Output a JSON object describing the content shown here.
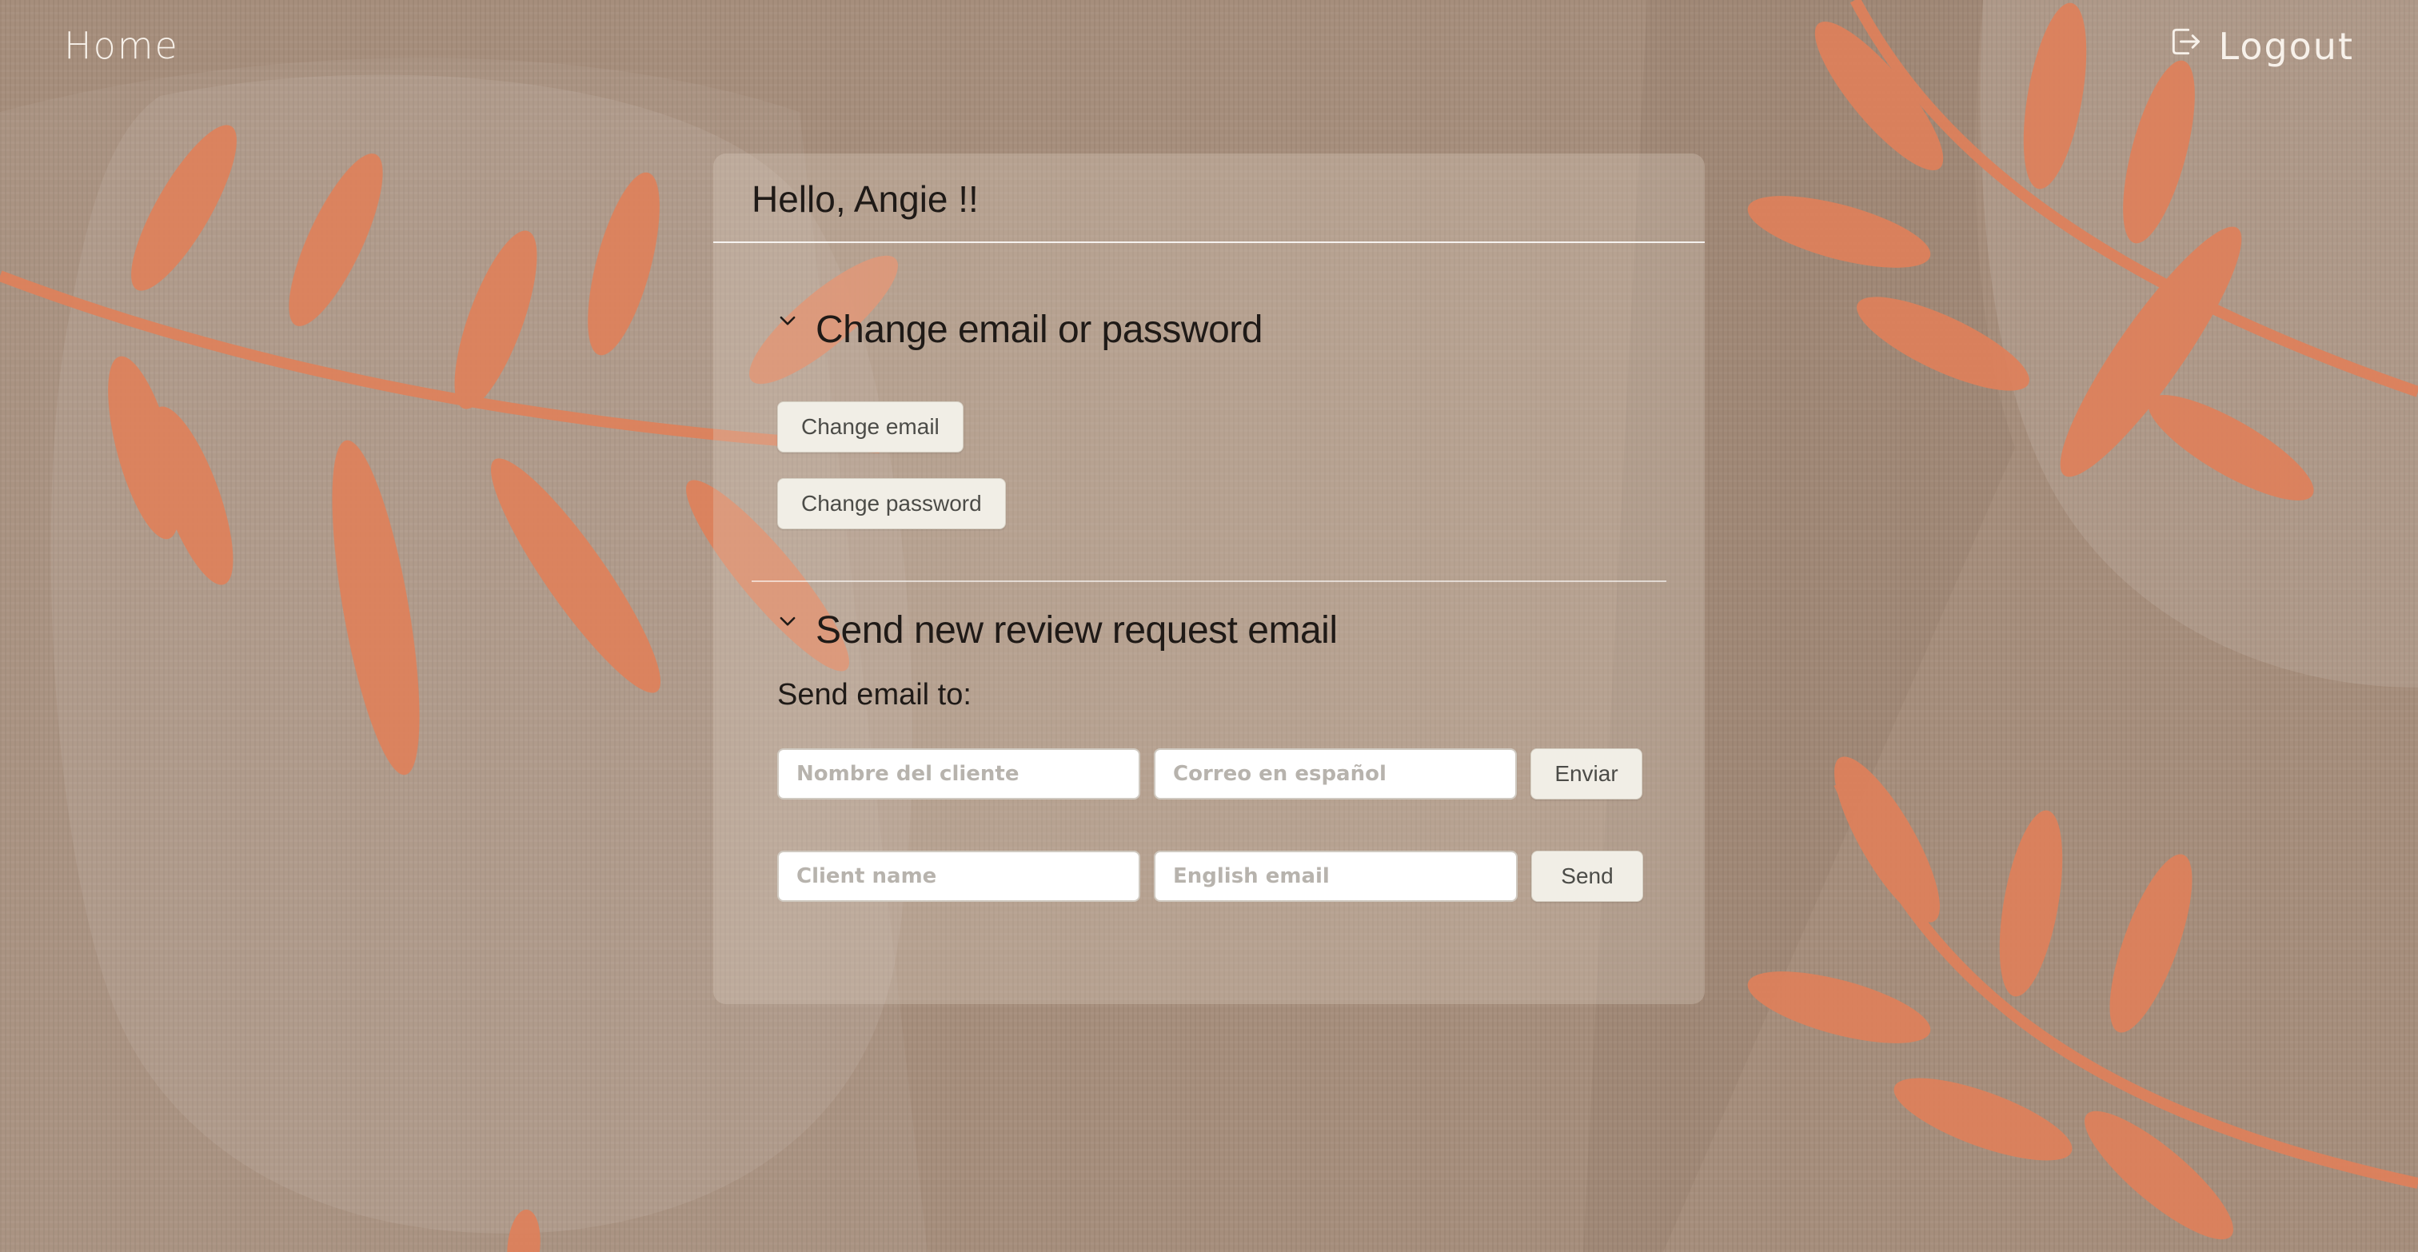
{
  "nav": {
    "home_label": "Home",
    "logout_label": "Logout",
    "logout_icon": "logout-icon"
  },
  "card": {
    "greeting": "Hello, Angie !!",
    "account_section": {
      "title": "Change email or password",
      "change_email_label": "Change email",
      "change_password_label": "Change password"
    },
    "review_section": {
      "title": "Send new review request email",
      "send_to_label": "Send email to:",
      "spanish_row": {
        "name_placeholder": "Nombre del cliente",
        "email_placeholder": "Correo en español",
        "submit_label": "Enviar"
      },
      "english_row": {
        "name_placeholder": "Client name",
        "email_placeholder": "English email",
        "submit_label": "Send"
      }
    }
  },
  "colors": {
    "background": "#a68e7c",
    "leaf": "#e0805a",
    "button_bg": "#f1eee6",
    "nav_text": "#f7f1ea"
  }
}
